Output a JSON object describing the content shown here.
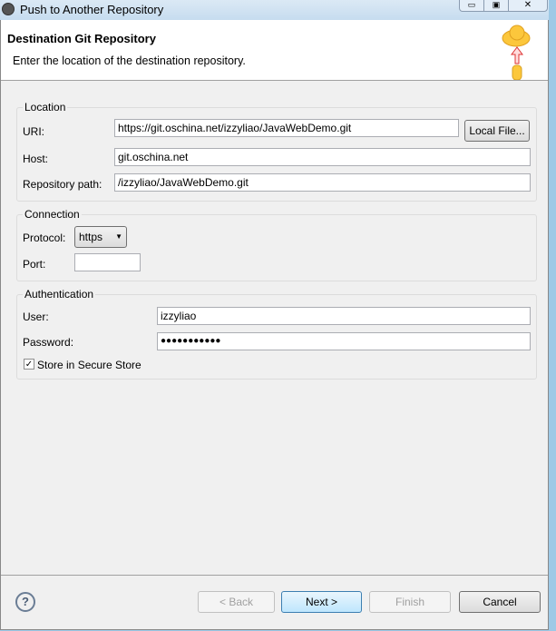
{
  "window": {
    "title": "Push to Another Repository"
  },
  "header": {
    "title": "Destination Git Repository",
    "description": "Enter the location of the destination repository."
  },
  "location": {
    "label": "Location",
    "uri_label": "URI:",
    "uri": "https://git.oschina.net/izzyliao/JavaWebDemo.git",
    "local_file": "Local File...",
    "host_label": "Host:",
    "host": "git.oschina.net",
    "path_label": "Repository path:",
    "path": "/izzyliao/JavaWebDemo.git"
  },
  "connection": {
    "label": "Connection",
    "protocol_label": "Protocol:",
    "protocol": "https",
    "port_label": "Port:",
    "port": ""
  },
  "auth": {
    "label": "Authentication",
    "user_label": "User:",
    "user": "izzyliao",
    "password_label": "Password:",
    "password": "●●●●●●●●●●●",
    "store_label": "Store in Secure Store",
    "store_checked": true
  },
  "buttons": {
    "back": "< Back",
    "next": "Next >",
    "finish": "Finish",
    "cancel": "Cancel"
  }
}
